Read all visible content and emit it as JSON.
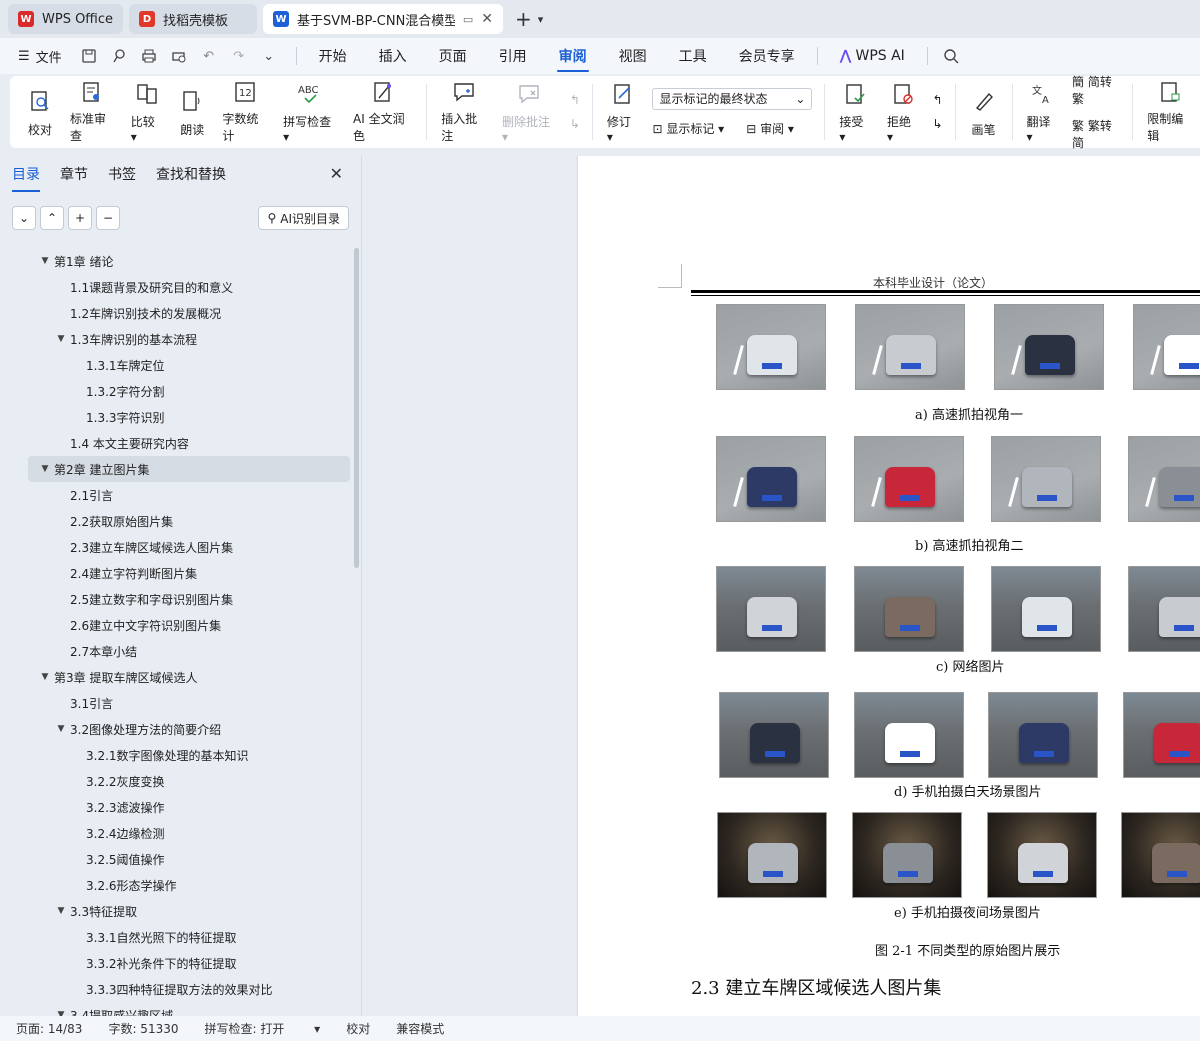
{
  "tabs": [
    {
      "label": "WPS Office",
      "logo": "W",
      "color": "#d92b2b"
    },
    {
      "label": "找稻壳模板",
      "logo": "D",
      "color": "#e0392b"
    },
    {
      "label": "基于SVM-BP-CNN混合模型",
      "logo": "W",
      "color": "#2060d6",
      "active": true
    }
  ],
  "menubar": {
    "file": "文件",
    "items": [
      "开始",
      "插入",
      "页面",
      "引用",
      "审阅",
      "视图",
      "工具",
      "会员专享",
      "WPS AI"
    ],
    "active": "审阅"
  },
  "ribbon": {
    "proof": "校对",
    "standard_review": "标准审查",
    "compare": "比较",
    "read_aloud": "朗读",
    "word_count": "字数统计",
    "spell_check": "拼写检查",
    "ai_polish": "AI 全文润色",
    "insert_comment": "插入批注",
    "delete_comment": "删除批注",
    "revise": "修订",
    "display_select": "显示标记的最终状态",
    "show_marks": "显示标记",
    "review": "审阅",
    "accept": "接受",
    "reject": "拒绝",
    "pen": "画笔",
    "translate": "翻译",
    "to_traditional": "简转繁",
    "to_simplified": "繁转简",
    "restrict_edit": "限制编辑"
  },
  "sidebar": {
    "tabs": [
      "目录",
      "章节",
      "书签",
      "查找和替换"
    ],
    "ai_toc": "AI识别目录",
    "toc": [
      {
        "label": "第1章 绪论",
        "level": 1,
        "expanded": true
      },
      {
        "label": "1.1课题背景及研究目的和意义",
        "level": 2
      },
      {
        "label": "1.2车牌识别技术的发展概况",
        "level": 2
      },
      {
        "label": "1.3车牌识别的基本流程",
        "level": 2,
        "expanded": true
      },
      {
        "label": "1.3.1车牌定位",
        "level": 3
      },
      {
        "label": "1.3.2字符分割",
        "level": 3
      },
      {
        "label": "1.3.3字符识别",
        "level": 3
      },
      {
        "label": "1.4 本文主要研究内容",
        "level": 2
      },
      {
        "label": "第2章 建立图片集",
        "level": 1,
        "expanded": true,
        "selected": true
      },
      {
        "label": "2.1引言",
        "level": 2
      },
      {
        "label": "2.2获取原始图片集",
        "level": 2
      },
      {
        "label": "2.3建立车牌区域候选人图片集",
        "level": 2
      },
      {
        "label": "2.4建立字符判断图片集",
        "level": 2
      },
      {
        "label": "2.5建立数字和字母识别图片集",
        "level": 2
      },
      {
        "label": "2.6建立中文字符识别图片集",
        "level": 2
      },
      {
        "label": "2.7本章小结",
        "level": 2
      },
      {
        "label": "第3章 提取车牌区域候选人",
        "level": 1,
        "expanded": true
      },
      {
        "label": "3.1引言",
        "level": 2
      },
      {
        "label": "3.2图像处理方法的简要介绍",
        "level": 2,
        "expanded": true
      },
      {
        "label": "3.2.1数字图像处理的基本知识",
        "level": 3
      },
      {
        "label": "3.2.2灰度变换",
        "level": 3
      },
      {
        "label": "3.2.3滤波操作",
        "level": 3
      },
      {
        "label": "3.2.4边缘检测",
        "level": 3
      },
      {
        "label": "3.2.5阈值操作",
        "level": 3
      },
      {
        "label": "3.2.6形态学操作",
        "level": 3
      },
      {
        "label": "3.3特征提取",
        "level": 2,
        "expanded": true
      },
      {
        "label": "3.3.1自然光照下的特征提取",
        "level": 3
      },
      {
        "label": "3.3.2补光条件下的特征提取",
        "level": 3
      },
      {
        "label": "3.3.3四种特征提取方法的效果对比",
        "level": 3
      },
      {
        "label": "3.4提取感兴趣区域",
        "level": 2,
        "expanded": true
      }
    ]
  },
  "document": {
    "header": "本科毕业设计（论文）",
    "captions": [
      "a)  高速抓拍视角一",
      "b)  高速抓拍视角二",
      "c)  网络图片",
      "d)  手机拍摄白天场景图片",
      "e)  手机拍摄夜间场景图片"
    ],
    "figure_caption": "图  2-1 不同类型的原始图片展示",
    "section_heading": "2.3   建立车牌区域候选人图片集"
  },
  "status": {
    "page": "页面: 14/83",
    "words": "字数: 51330",
    "spell": "拼写检查: 打开",
    "proof": "校对",
    "compat": "兼容模式"
  }
}
